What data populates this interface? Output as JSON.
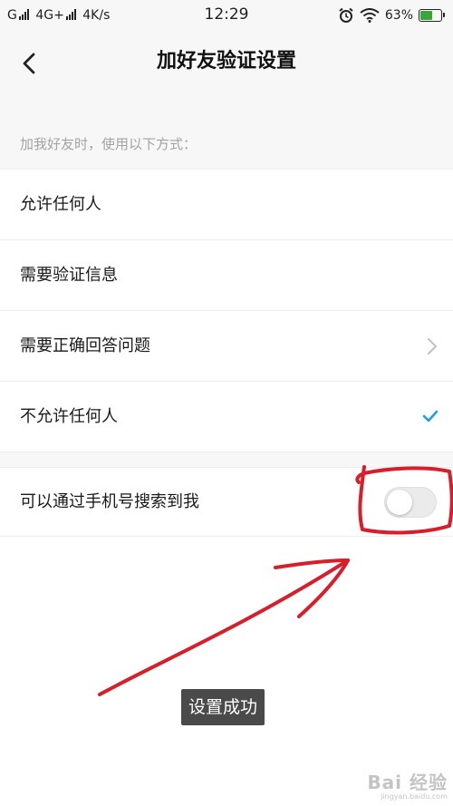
{
  "status_bar": {
    "carrier_left": "G",
    "network": "4G+",
    "speed": "4K/s",
    "time": "12:29",
    "battery_percent": "63%",
    "battery_level": 0.63,
    "alarm_icon": "alarm-icon",
    "wifi_icon": "wifi-icon"
  },
  "header": {
    "title": "加好友验证设置",
    "back_icon": "chevron-left-icon"
  },
  "section": {
    "hint": "加我好友时，使用以下方式："
  },
  "options": [
    {
      "label": "允许任何人",
      "indicator": "none"
    },
    {
      "label": "需要验证信息",
      "indicator": "none"
    },
    {
      "label": "需要正确回答问题",
      "indicator": "chevron-right-icon"
    },
    {
      "label": "不允许任何人",
      "indicator": "check-icon",
      "selected": true
    }
  ],
  "phone_search": {
    "label": "可以通过手机号搜索到我",
    "enabled": false
  },
  "toast": {
    "message": "设置成功"
  },
  "watermark": {
    "brand": "Bai 经验",
    "url": "jingyan.baidu.com"
  },
  "colors": {
    "background": "#ffffff",
    "section_bg": "#f7f7f7",
    "hint_text": "#a3a3a3",
    "check_blue": "#1e9bf0",
    "annotation_red": "#d81e2a",
    "toast_bg": "#4a4a4a"
  }
}
